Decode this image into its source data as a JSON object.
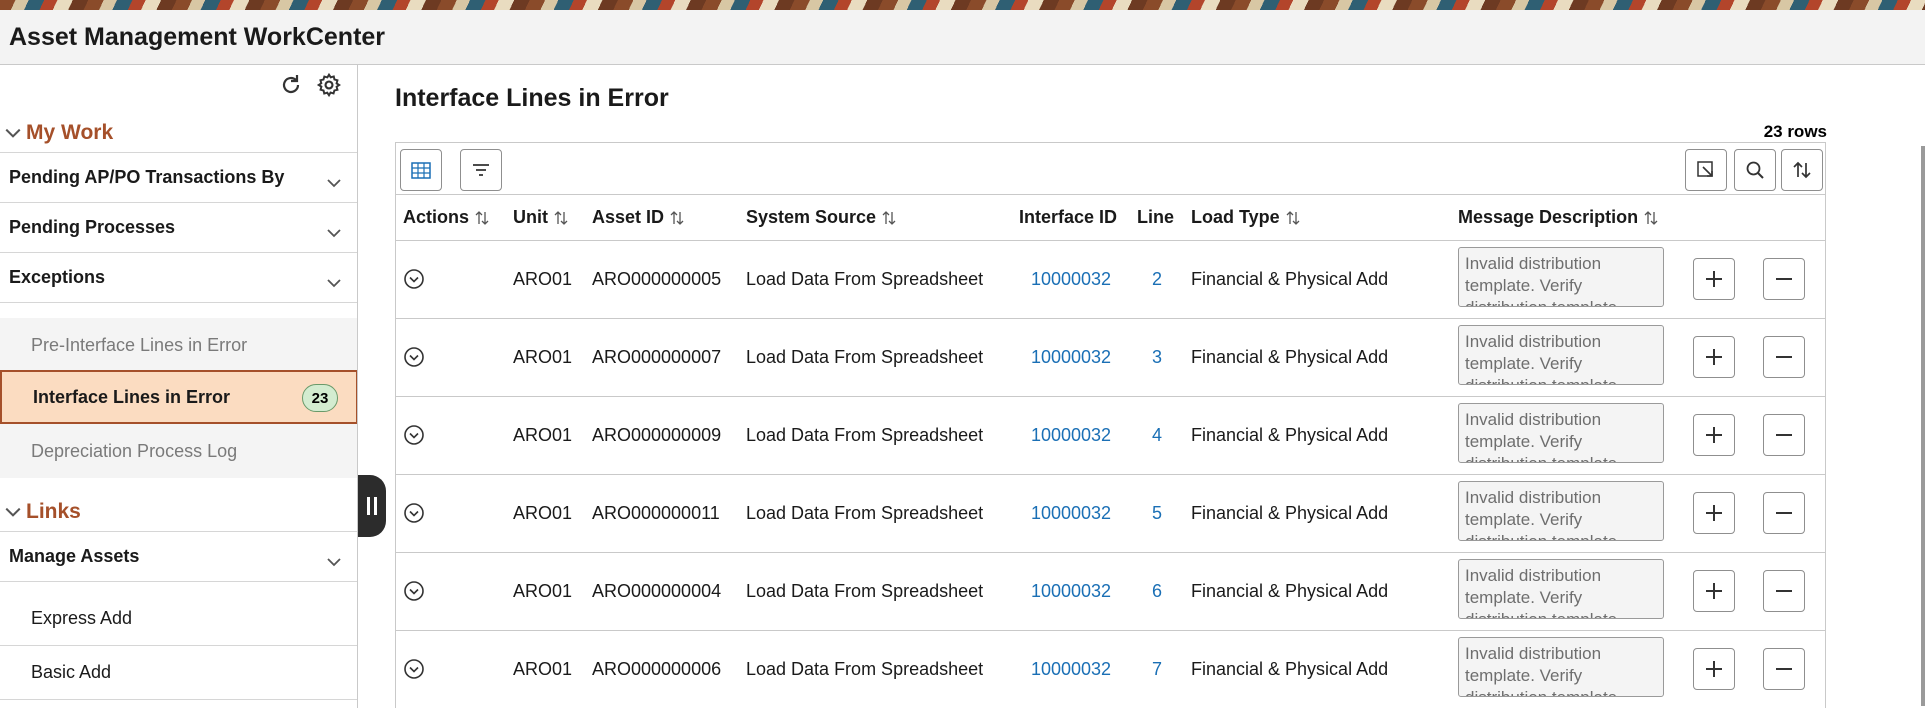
{
  "app": {
    "title": "Asset Management WorkCenter"
  },
  "sidebar": {
    "my_work": "My Work",
    "groups": [
      {
        "label": "Pending AP/PO Transactions By"
      },
      {
        "label": "Pending Processes"
      },
      {
        "label": "Exceptions"
      }
    ],
    "exceptions_items": [
      {
        "label": "Pre-Interface Lines in Error"
      },
      {
        "label": "Interface Lines in Error",
        "count": "23"
      },
      {
        "label": "Depreciation Process Log"
      }
    ],
    "links": "Links",
    "manage_assets": "Manage Assets",
    "links_items": [
      {
        "label": "Express Add"
      },
      {
        "label": "Basic Add"
      }
    ]
  },
  "main": {
    "title": "Interface Lines in Error",
    "row_count": "23 rows",
    "columns": {
      "actions": "Actions",
      "unit": "Unit",
      "asset_id": "Asset ID",
      "system_source": "System Source",
      "interface_id": "Interface ID",
      "line": "Line",
      "load_type": "Load Type",
      "message": "Message Description"
    },
    "rows": [
      {
        "unit": "ARO01",
        "asset_id": "ARO000000005",
        "source": "Load Data From Spreadsheet",
        "interface_id": "10000032",
        "line": "2",
        "load_type": "Financial & Physical Add",
        "message": "Invalid distribution template. Verify distribution template"
      },
      {
        "unit": "ARO01",
        "asset_id": "ARO000000007",
        "source": "Load Data From Spreadsheet",
        "interface_id": "10000032",
        "line": "3",
        "load_type": "Financial & Physical Add",
        "message": "Invalid distribution template. Verify distribution template"
      },
      {
        "unit": "ARO01",
        "asset_id": "ARO000000009",
        "source": "Load Data From Spreadsheet",
        "interface_id": "10000032",
        "line": "4",
        "load_type": "Financial & Physical Add",
        "message": "Invalid distribution template. Verify distribution template"
      },
      {
        "unit": "ARO01",
        "asset_id": "ARO000000011",
        "source": "Load Data From Spreadsheet",
        "interface_id": "10000032",
        "line": "5",
        "load_type": "Financial & Physical Add",
        "message": "Invalid distribution template. Verify distribution template"
      },
      {
        "unit": "ARO01",
        "asset_id": "ARO000000004",
        "source": "Load Data From Spreadsheet",
        "interface_id": "10000032",
        "line": "6",
        "load_type": "Financial & Physical Add",
        "message": "Invalid distribution template. Verify distribution template"
      },
      {
        "unit": "ARO01",
        "asset_id": "ARO000000006",
        "source": "Load Data From Spreadsheet",
        "interface_id": "10000032",
        "line": "7",
        "load_type": "Financial & Physical Add",
        "message": "Invalid distribution template. Verify distribution template"
      }
    ]
  },
  "colors": {
    "accent": "#a5502a",
    "link": "#1a6fb5",
    "active_bg": "#fbdcc1",
    "badge_bg": "#d3ecd0"
  },
  "icons": [
    "refresh-icon",
    "gear-icon",
    "chevron-down-icon",
    "grid-view-icon",
    "filter-icon",
    "export-icon",
    "search-icon",
    "sort-icon",
    "row-actions-icon",
    "plus-icon",
    "minus-icon"
  ]
}
